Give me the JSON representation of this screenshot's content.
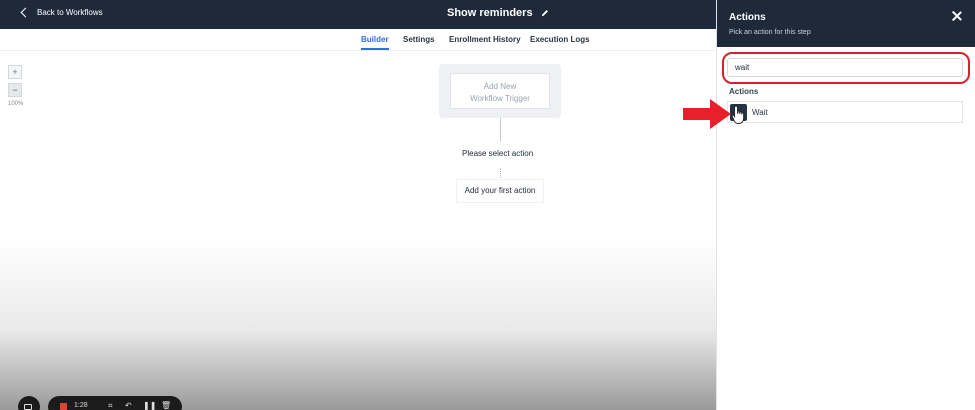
{
  "header": {
    "back_label": "Back to Workflows",
    "title": "Show reminders"
  },
  "tabs": [
    {
      "label": "Builder",
      "active": true
    },
    {
      "label": "Settings",
      "active": false
    },
    {
      "label": "Enrollment History",
      "active": false
    },
    {
      "label": "Execution Logs",
      "active": false
    }
  ],
  "canvas": {
    "zoom_in": "+",
    "zoom_out": "−",
    "zoom_level": "100%",
    "trigger_line1": "Add New",
    "trigger_line2": "Workflow Trigger",
    "select_action": "Please select action",
    "first_action": "Add your first action"
  },
  "recorder": {
    "time": "1:28"
  },
  "panel": {
    "title": "Actions",
    "subtitle": "Pick an action for this step",
    "search_value": "wait",
    "section_label": "Actions",
    "items": [
      {
        "label": "Wait"
      }
    ]
  },
  "colors": {
    "header_bg": "#1e2a3a",
    "accent": "#2f6fd6",
    "highlight_red": "#d6222e"
  }
}
